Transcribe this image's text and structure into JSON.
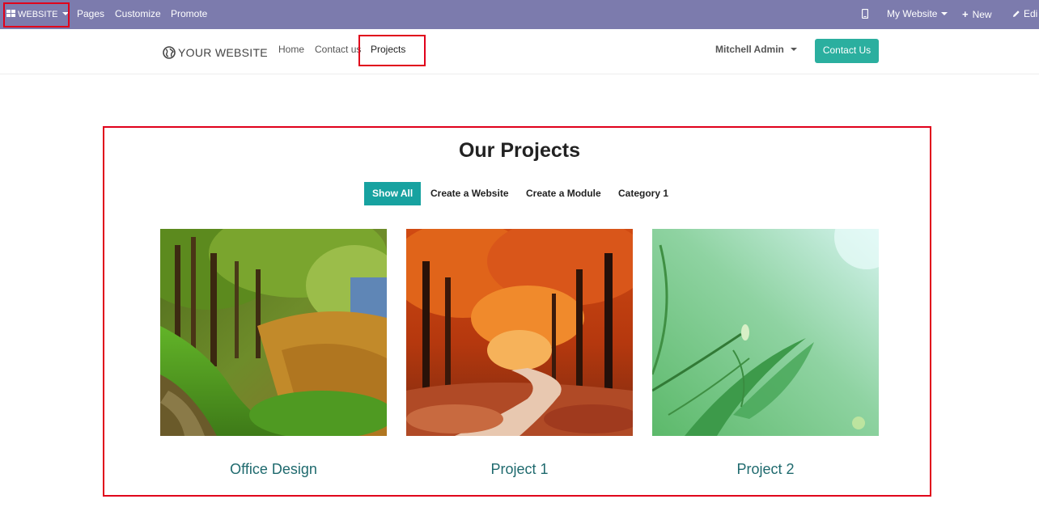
{
  "admin_bar": {
    "app_label": "WEBSITE",
    "menu": [
      "Pages",
      "Customize",
      "Promote"
    ],
    "website_selector": "My Website",
    "new_label": "New",
    "edit_label": "Edi"
  },
  "site_nav": {
    "logo_text": "YOUR WEBSITE",
    "links": [
      "Home",
      "Contact us",
      "Projects"
    ],
    "user": "Mitchell Admin",
    "cta": "Contact Us"
  },
  "section": {
    "title": "Our Projects",
    "filters": [
      "Show All",
      "Create a Website",
      "Create a Module",
      "Category 1"
    ],
    "active_filter": "Show All",
    "projects": [
      {
        "name": "Office Design"
      },
      {
        "name": "Project 1"
      },
      {
        "name": "Project 2"
      }
    ]
  },
  "colors": {
    "admin_bar": "#7c7bad",
    "accent": "#17a2a0",
    "cta": "#2baf9f",
    "highlight": "#e0001b",
    "project_label": "#1f6a6e"
  }
}
